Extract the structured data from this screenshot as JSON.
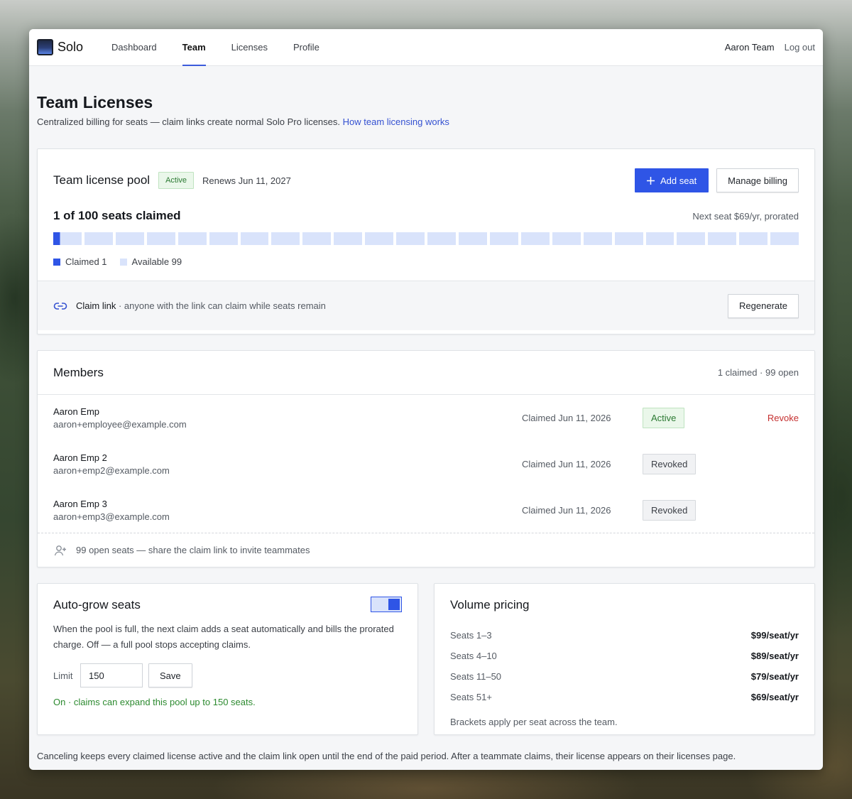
{
  "nav": {
    "brand": "Solo",
    "links": [
      "Dashboard",
      "Team",
      "Licenses",
      "Profile"
    ],
    "active": "Team",
    "user": "Aaron Team",
    "logout": "Log out"
  },
  "header": {
    "title": "Team Licenses",
    "subtitle": "Centralized billing for seats — claim links create normal Solo Pro licenses.",
    "help_link": "How team licensing works"
  },
  "pool": {
    "title": "Team license pool",
    "status": "Active",
    "renews": "Renews Jun 11, 2027",
    "add_seat": "Add seat",
    "manage_billing": "Manage billing",
    "seats_claimed": "1 of 100 seats claimed",
    "next_seat": "Next seat $69/yr, prorated",
    "claimed": 1,
    "total": 100,
    "legend_claimed": "Claimed 1",
    "legend_available": "Available 99",
    "claim_link_label": "Claim link",
    "claim_link_desc": " · anyone with the link can claim while seats remain",
    "regenerate": "Regenerate"
  },
  "members": {
    "title": "Members",
    "count": "1 claimed · 99 open",
    "rows": [
      {
        "name": "Aaron Emp",
        "email": "aaron+employee@example.com",
        "claimed": "Claimed Jun 11, 2026",
        "status": "Active",
        "action": "Revoke"
      },
      {
        "name": "Aaron Emp 2",
        "email": "aaron+emp2@example.com",
        "claimed": "Claimed Jun 11, 2026",
        "status": "Revoked",
        "action": ""
      },
      {
        "name": "Aaron Emp 3",
        "email": "aaron+emp3@example.com",
        "claimed": "Claimed Jun 11, 2026",
        "status": "Revoked",
        "action": ""
      }
    ],
    "footer": "99 open seats — share the claim link to invite teammates"
  },
  "autogrow": {
    "title": "Auto-grow seats",
    "enabled": true,
    "description": "When the pool is full, the next claim adds a seat automatically and bills the prorated charge. Off — a full pool stops accepting claims.",
    "limit_label": "Limit",
    "limit_value": "150",
    "save": "Save",
    "status": "On · claims can expand this pool up to 150 seats."
  },
  "volume": {
    "title": "Volume pricing",
    "rows": [
      {
        "label": "Seats 1–3",
        "price": "$99/seat/yr"
      },
      {
        "label": "Seats 4–10",
        "price": "$89/seat/yr"
      },
      {
        "label": "Seats 11–50",
        "price": "$79/seat/yr"
      },
      {
        "label": "Seats 51+",
        "price": "$69/seat/yr"
      }
    ],
    "note": "Brackets apply per seat across the team."
  },
  "footer_note": "Canceling keeps every claimed license active and the claim link open until the end of the paid period. After a teammate claims, their license appears on their licenses page.",
  "colors": {
    "accent": "#2f55e6",
    "active_green": "#2c7a33",
    "danger": "#c53030"
  }
}
